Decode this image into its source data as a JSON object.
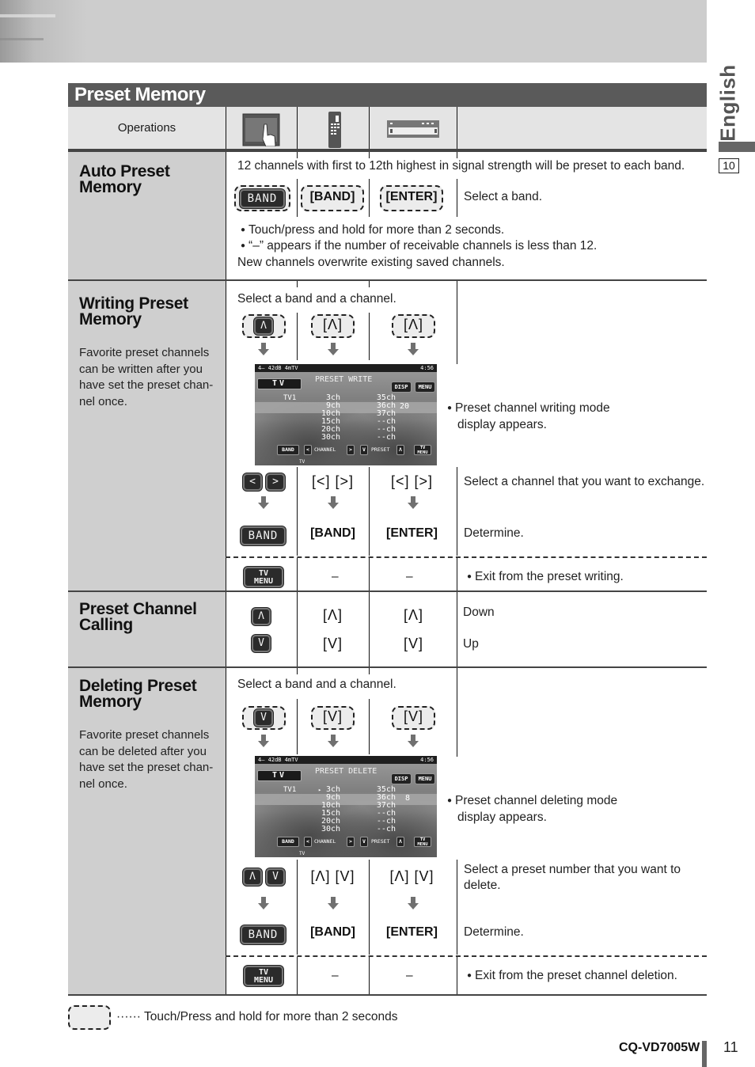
{
  "side_tab": {
    "language": "English",
    "page_ref": "10"
  },
  "section": {
    "title": "Preset Memory"
  },
  "header": {
    "operations_label": "Operations",
    "columns": [
      {
        "icon": "touch-panel-icon"
      },
      {
        "icon": "remote-control-icon"
      },
      {
        "icon": "main-unit-icon"
      }
    ]
  },
  "rows": {
    "auto_preset": {
      "title_line1": "Auto Preset",
      "title_line2": "Memory",
      "intro": "12 channels with first to 12th highest in signal strength will be preset to each band.",
      "touch_button": "BAND",
      "remote_key": "[BAND]",
      "unit_key": "[ENTER]",
      "action": "Select a band.",
      "note1": "Touch/press and hold for more than 2 seconds.",
      "note2": "“–” appears if the number of receivable channels is less than 12.",
      "note3": "New channels overwrite existing saved channels."
    },
    "writing_preset": {
      "title_line1": "Writing Preset",
      "title_line2": "Memory",
      "desc_lines": [
        "Favorite preset channels",
        "can be written after you",
        "have set the preset chan-",
        "nel once."
      ],
      "step1_text": "Select a band and a channel.",
      "step1_touch": "Λ",
      "step1_remote": "[Λ]",
      "step1_unit": "[Λ]",
      "screen_note_line1": "Preset channel writing mode",
      "screen_note_line2": "display appears.",
      "step2_touch_left": "<",
      "step2_touch_right": ">",
      "step2_remote": "[<] [>]",
      "step2_unit": "[<] [>]",
      "step2_action": "Select a channel that you want to exchange.",
      "step3_touch": "BAND",
      "step3_remote": "[BAND]",
      "step3_unit": "[ENTER]",
      "step3_action": "Determine.",
      "exit_touch_line1": "TV",
      "exit_touch_line2": "MENU",
      "exit_remote": "–",
      "exit_unit": "–",
      "exit_action": "Exit from the preset writing."
    },
    "preset_calling": {
      "title_line1": "Preset Channel",
      "title_line2": "Calling",
      "up_touch": "Λ",
      "up_remote": "[Λ]",
      "up_unit": "[Λ]",
      "up_action": "Down",
      "down_touch": "V",
      "down_remote": "[V]",
      "down_unit": "[V]",
      "down_action": "Up"
    },
    "deleting_preset": {
      "title_line1": "Deleting Preset",
      "title_line2": "Memory",
      "desc_lines": [
        "Favorite preset channels",
        "can be deleted after you",
        "have set the preset chan-",
        "nel once."
      ],
      "step1_text": "Select a band and a channel.",
      "step1_touch": "V",
      "step1_remote": "[V]",
      "step1_unit": "[V]",
      "screen_note_line1": "Preset channel deleting mode",
      "screen_note_line2": "display appears.",
      "step2_touch_left": "Λ",
      "step2_touch_right": "V",
      "step2_remote": "[Λ] [V]",
      "step2_unit": "[Λ] [V]",
      "step2_action_line1": "Select a preset number that you want to",
      "step2_action_line2": "delete.",
      "step3_touch": "BAND",
      "step3_remote": "[BAND]",
      "step3_unit": "[ENTER]",
      "step3_action": "Determine.",
      "exit_touch_line1": "TV",
      "exit_touch_line2": "MENU",
      "exit_remote": "–",
      "exit_unit": "–",
      "exit_action": "Exit from the preset channel deletion."
    }
  },
  "screens": {
    "write": {
      "status_left": "4– 42dB  4mTV",
      "clock": "4:56",
      "source": "TV",
      "mode": "PRESET WRITE",
      "disp": "DISP",
      "menu": "MENU",
      "band_name": "TV1",
      "left_channels": [
        "3ch",
        "9ch",
        "10ch",
        "15ch",
        "20ch",
        "30ch"
      ],
      "right_channels": [
        "35ch",
        "36ch",
        "37ch",
        "--ch",
        "--ch",
        "--ch"
      ],
      "marker_number": "20",
      "cursor": "",
      "bottom": {
        "band": "BAND",
        "prev": "<",
        "channel": "CHANNEL",
        "next": ">",
        "down": "V",
        "preset": "PRESET",
        "up": "Λ",
        "tvmenu1": "TV",
        "tvmenu2": "MENU"
      },
      "footer_tag": "TV"
    },
    "delete": {
      "status_left": "4– 42dB  4mTV",
      "clock": "4:56",
      "source": "TV",
      "mode": "PRESET DELETE",
      "disp": "DISP",
      "menu": "MENU",
      "band_name": "TV1",
      "left_channels": [
        "3ch",
        "9ch",
        "10ch",
        "15ch",
        "20ch",
        "30ch"
      ],
      "right_channels": [
        "35ch",
        "36ch",
        "37ch",
        "--ch",
        "--ch",
        "--ch"
      ],
      "marker_number": "8",
      "cursor": "▸",
      "bottom": {
        "band": "BAND",
        "prev": "<",
        "channel": "CHANNEL",
        "next": ">",
        "down": "V",
        "preset": "PRESET",
        "up": "Λ",
        "tvmenu1": "TV",
        "tvmenu2": "MENU"
      },
      "footer_tag": "TV"
    }
  },
  "legend": {
    "dots": "······",
    "text": "Touch/Press and hold for more than 2 seconds"
  },
  "footer": {
    "model": "CQ-VD7005W",
    "page_number": "11"
  }
}
